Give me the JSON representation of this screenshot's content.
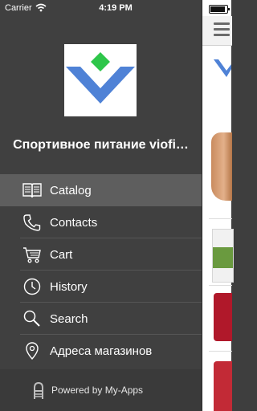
{
  "status_bar": {
    "carrier": "Carrier",
    "time": "4:19 PM"
  },
  "drawer": {
    "app_title": "Спортивное питание viofi…",
    "menu": [
      {
        "label": "Catalog",
        "icon": "book-icon",
        "active": true
      },
      {
        "label": "Contacts",
        "icon": "phone-icon",
        "active": false
      },
      {
        "label": "Cart",
        "icon": "cart-icon",
        "active": false
      },
      {
        "label": "History",
        "icon": "clock-icon",
        "active": false
      },
      {
        "label": "Search",
        "icon": "search-icon",
        "active": false
      },
      {
        "label": "Адреса магазинов",
        "icon": "location-pin-icon",
        "active": false
      }
    ],
    "footer": {
      "powered_by": "Powered by My-Apps"
    }
  },
  "colors": {
    "drawer_bg": "#404040",
    "active_item_bg": "#5e5e5e",
    "logo_blue": "#4f82d6",
    "logo_green": "#2ec64a"
  }
}
